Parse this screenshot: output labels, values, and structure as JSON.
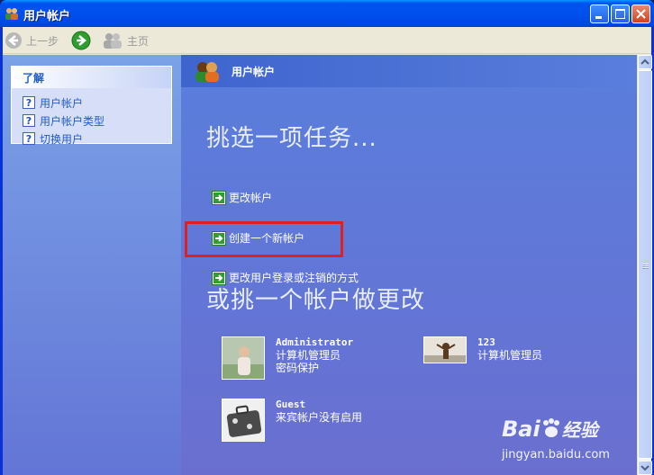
{
  "window": {
    "title": "用户帐户"
  },
  "toolbar": {
    "back_label": "上一步",
    "home_label": "主页"
  },
  "learn_box": {
    "title": "了解",
    "items": [
      {
        "label": "用户帐户"
      },
      {
        "label": "用户帐户类型"
      },
      {
        "label": "切换用户"
      }
    ]
  },
  "main": {
    "banner_title": "用户帐户",
    "task_heading": "挑选一项任务...",
    "tasks": [
      {
        "label": "更改帐户"
      },
      {
        "label": "创建一个新帐户"
      },
      {
        "label": "更改用户登录或注销的方式"
      }
    ],
    "account_heading": "或挑一个帐户做更改",
    "accounts": [
      {
        "name": "Administrator",
        "type": "计算机管理员",
        "note": "密码保护"
      },
      {
        "name": "123",
        "type": "计算机管理员"
      },
      {
        "name": "Guest",
        "type": "来宾帐户没有启用"
      }
    ]
  },
  "watermark": {
    "logo_text": "Bai",
    "logo_text2": "经验",
    "url": "jingyan.baidu.com"
  },
  "colors": {
    "highlight": "#e02020",
    "titlebar": "#0053ee",
    "main_bg": "#6375d6"
  }
}
